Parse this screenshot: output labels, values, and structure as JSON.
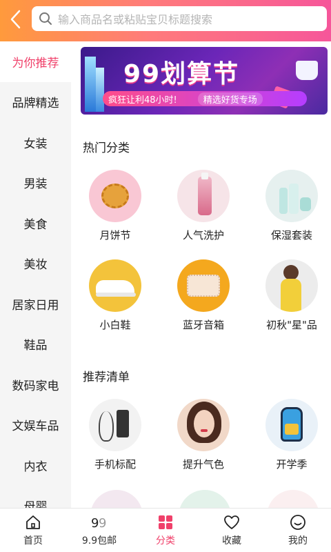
{
  "header": {
    "search_placeholder": "输入商品名或粘贴宝贝标题搜索"
  },
  "sidebar": {
    "items": [
      "为你推荐",
      "品牌精选",
      "女装",
      "男装",
      "美食",
      "美妆",
      "居家日用",
      "鞋品",
      "数码家电",
      "文娱车品",
      "内衣",
      "母婴"
    ],
    "active_index": 0
  },
  "banner": {
    "title": "99划算节",
    "promo": "疯狂让利48小时!",
    "sub": "精选好货专场"
  },
  "hot": {
    "title": "热门分类",
    "items": [
      {
        "label": "月饼节"
      },
      {
        "label": "人气洗护"
      },
      {
        "label": "保湿套装"
      },
      {
        "label": "小白鞋"
      },
      {
        "label": "蓝牙音箱"
      },
      {
        "label": "初秋\"星\"品"
      }
    ]
  },
  "recommend": {
    "title": "推荐清单",
    "items": [
      {
        "label": "手机标配"
      },
      {
        "label": "提升气色"
      },
      {
        "label": "开学季"
      }
    ]
  },
  "bottom_nav": {
    "items": [
      "首页",
      "9.9包邮",
      "分类",
      "收藏",
      "我的"
    ],
    "active_index": 2
  },
  "colors": {
    "accent": "#f0406a",
    "header_start": "#ff9a3c",
    "header_end": "#f6569a"
  }
}
